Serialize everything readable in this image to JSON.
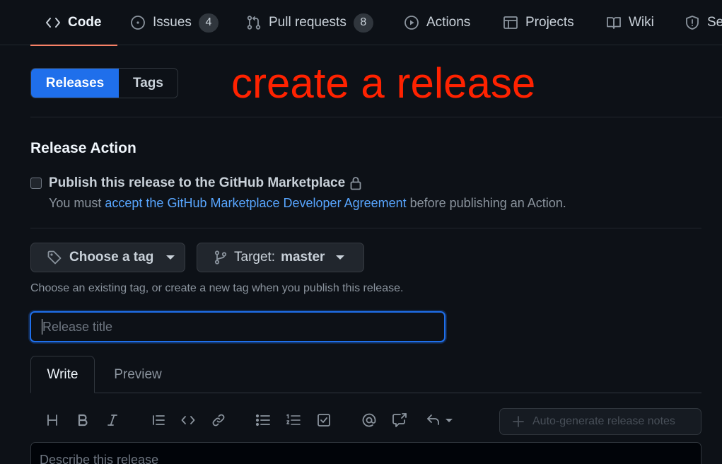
{
  "nav": {
    "tabs": [
      {
        "label": "Code",
        "icon": "code-icon",
        "selected": true
      },
      {
        "label": "Issues",
        "icon": "issue-opened-icon",
        "count": "4"
      },
      {
        "label": "Pull requests",
        "icon": "git-pull-request-icon",
        "count": "8"
      },
      {
        "label": "Actions",
        "icon": "play-icon"
      },
      {
        "label": "Projects",
        "icon": "table-icon"
      },
      {
        "label": "Wiki",
        "icon": "book-icon"
      },
      {
        "label": "Se",
        "icon": "shield-icon"
      }
    ],
    "accent_underline": "#f78166"
  },
  "switcher": {
    "releases": "Releases",
    "tags": "Tags",
    "active": "Releases",
    "active_color": "#1f6feb"
  },
  "annotation": {
    "text": "create a release",
    "color": "#ff2200"
  },
  "release_action": {
    "heading": "Release Action",
    "checkbox_label": "Publish this release to the GitHub Marketplace",
    "checked": false,
    "note_prefix": "You must ",
    "note_link": "accept the GitHub Marketplace Developer Agreement",
    "note_suffix": " before publishing an Action."
  },
  "tag_picker": {
    "label": "Choose a tag",
    "icon": "tag-icon"
  },
  "target_picker": {
    "label": "Target:",
    "value": "master",
    "icon": "git-branch-icon"
  },
  "hint": "Choose an existing tag, or create a new tag when you publish this release.",
  "title_input": {
    "placeholder": "Release title",
    "value": ""
  },
  "editor": {
    "tabs": {
      "write": "Write",
      "preview": "Preview"
    },
    "active_tab": "Write",
    "toolbar": [
      "heading-icon",
      "bold-icon",
      "italic-icon",
      "quote-icon",
      "code-icon",
      "link-icon",
      "unordered-list-icon",
      "ordered-list-icon",
      "tasklist-icon",
      "mention-icon",
      "cross-reference-icon",
      "reply-icon"
    ],
    "autogen_label": "Auto-generate release notes",
    "autogen_enabled": false,
    "description_placeholder": "Describe this release"
  }
}
